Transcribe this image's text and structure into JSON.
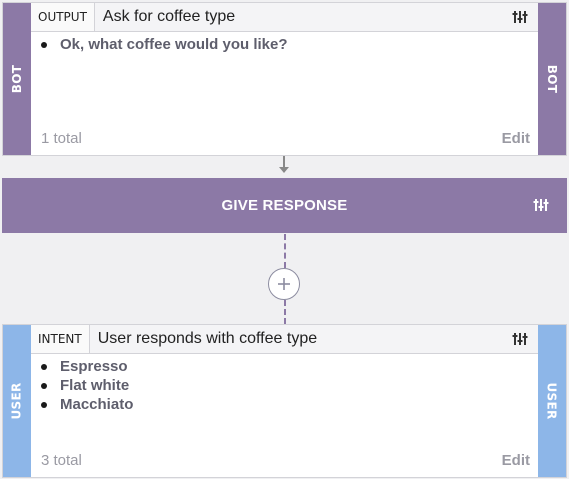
{
  "bot_card": {
    "side_label": "BOT",
    "tag": "OUTPUT",
    "title": "Ask for coffee type",
    "items": [
      "Ok, what coffee would you like?"
    ],
    "total": "1 total",
    "edit_label": "Edit"
  },
  "response": {
    "label": "GIVE RESPONSE"
  },
  "user_card": {
    "side_label": "USER",
    "tag": "INTENT",
    "title": "User responds with coffee type",
    "items": [
      "Espresso",
      "Flat white",
      "Macchiato"
    ],
    "total": "3 total",
    "edit_label": "Edit"
  },
  "icons": {
    "settings": "tune-sliders-icon",
    "add": "plus-icon",
    "connector": "arrow-down-icon"
  },
  "colors": {
    "bot": "#8c79a6",
    "user": "#8db6e8",
    "muted_text": "#9a9aa3"
  }
}
